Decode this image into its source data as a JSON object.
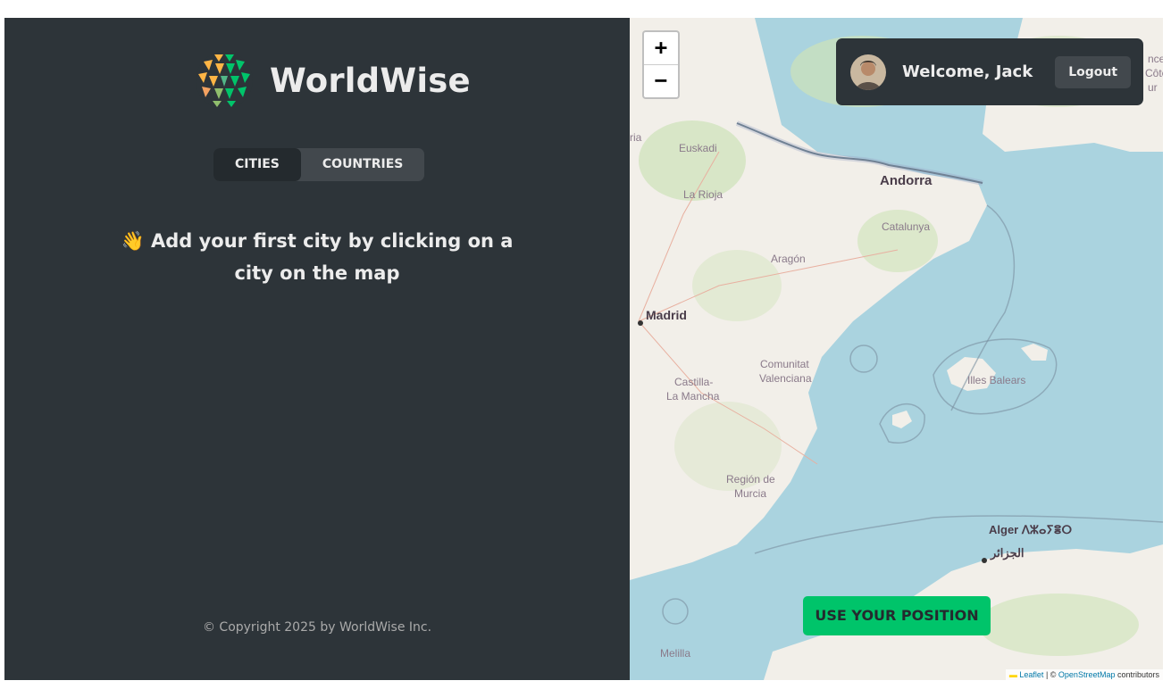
{
  "sidebar": {
    "logo_text": "WorldWise",
    "tabs": [
      {
        "label": "Cities",
        "active": true
      },
      {
        "label": "Countries",
        "active": false
      }
    ],
    "empty_message": "👋 Add your first city by clicking on a city on the map",
    "copyright": "© Copyright 2025 by WorldWise Inc."
  },
  "map": {
    "zoom_in": "+",
    "zoom_out": "−",
    "use_position": "Use your position",
    "labels": {
      "andorra": "Andorra",
      "euskadi": "Euskadi",
      "la_rioja": "La Rioja",
      "catalunya": "Catalunya",
      "aragon": "Aragón",
      "madrid": "Madrid",
      "comunitat": "Comunitat",
      "valenciana": "Valenciana",
      "castilla": "Castilla-",
      "la_mancha": "La Mancha",
      "illes_balears": "Illes Balears",
      "region_de": "Región de",
      "murcia": "Murcia",
      "alger": "Alger ⴷⵣⴰⵢⴻⵔ",
      "aljazair": "الجزائر",
      "melilla": "Melilla",
      "edge_top": "ria",
      "edge_right_1": "nce",
      "edge_right_2": "Côte",
      "edge_right_3": "ur"
    },
    "attribution": {
      "leaflet": "Leaflet",
      "sep": " | © ",
      "osm": "OpenStreetMap",
      "contributors": " contributors"
    }
  },
  "user": {
    "welcome": "Welcome, Jack",
    "logout": "Logout"
  },
  "colors": {
    "sidebar_bg": "#2d3439",
    "tab_active_bg": "#242a2e",
    "accent_green": "#00c46a",
    "sea": "#aad3df",
    "land": "#f2efe9"
  }
}
